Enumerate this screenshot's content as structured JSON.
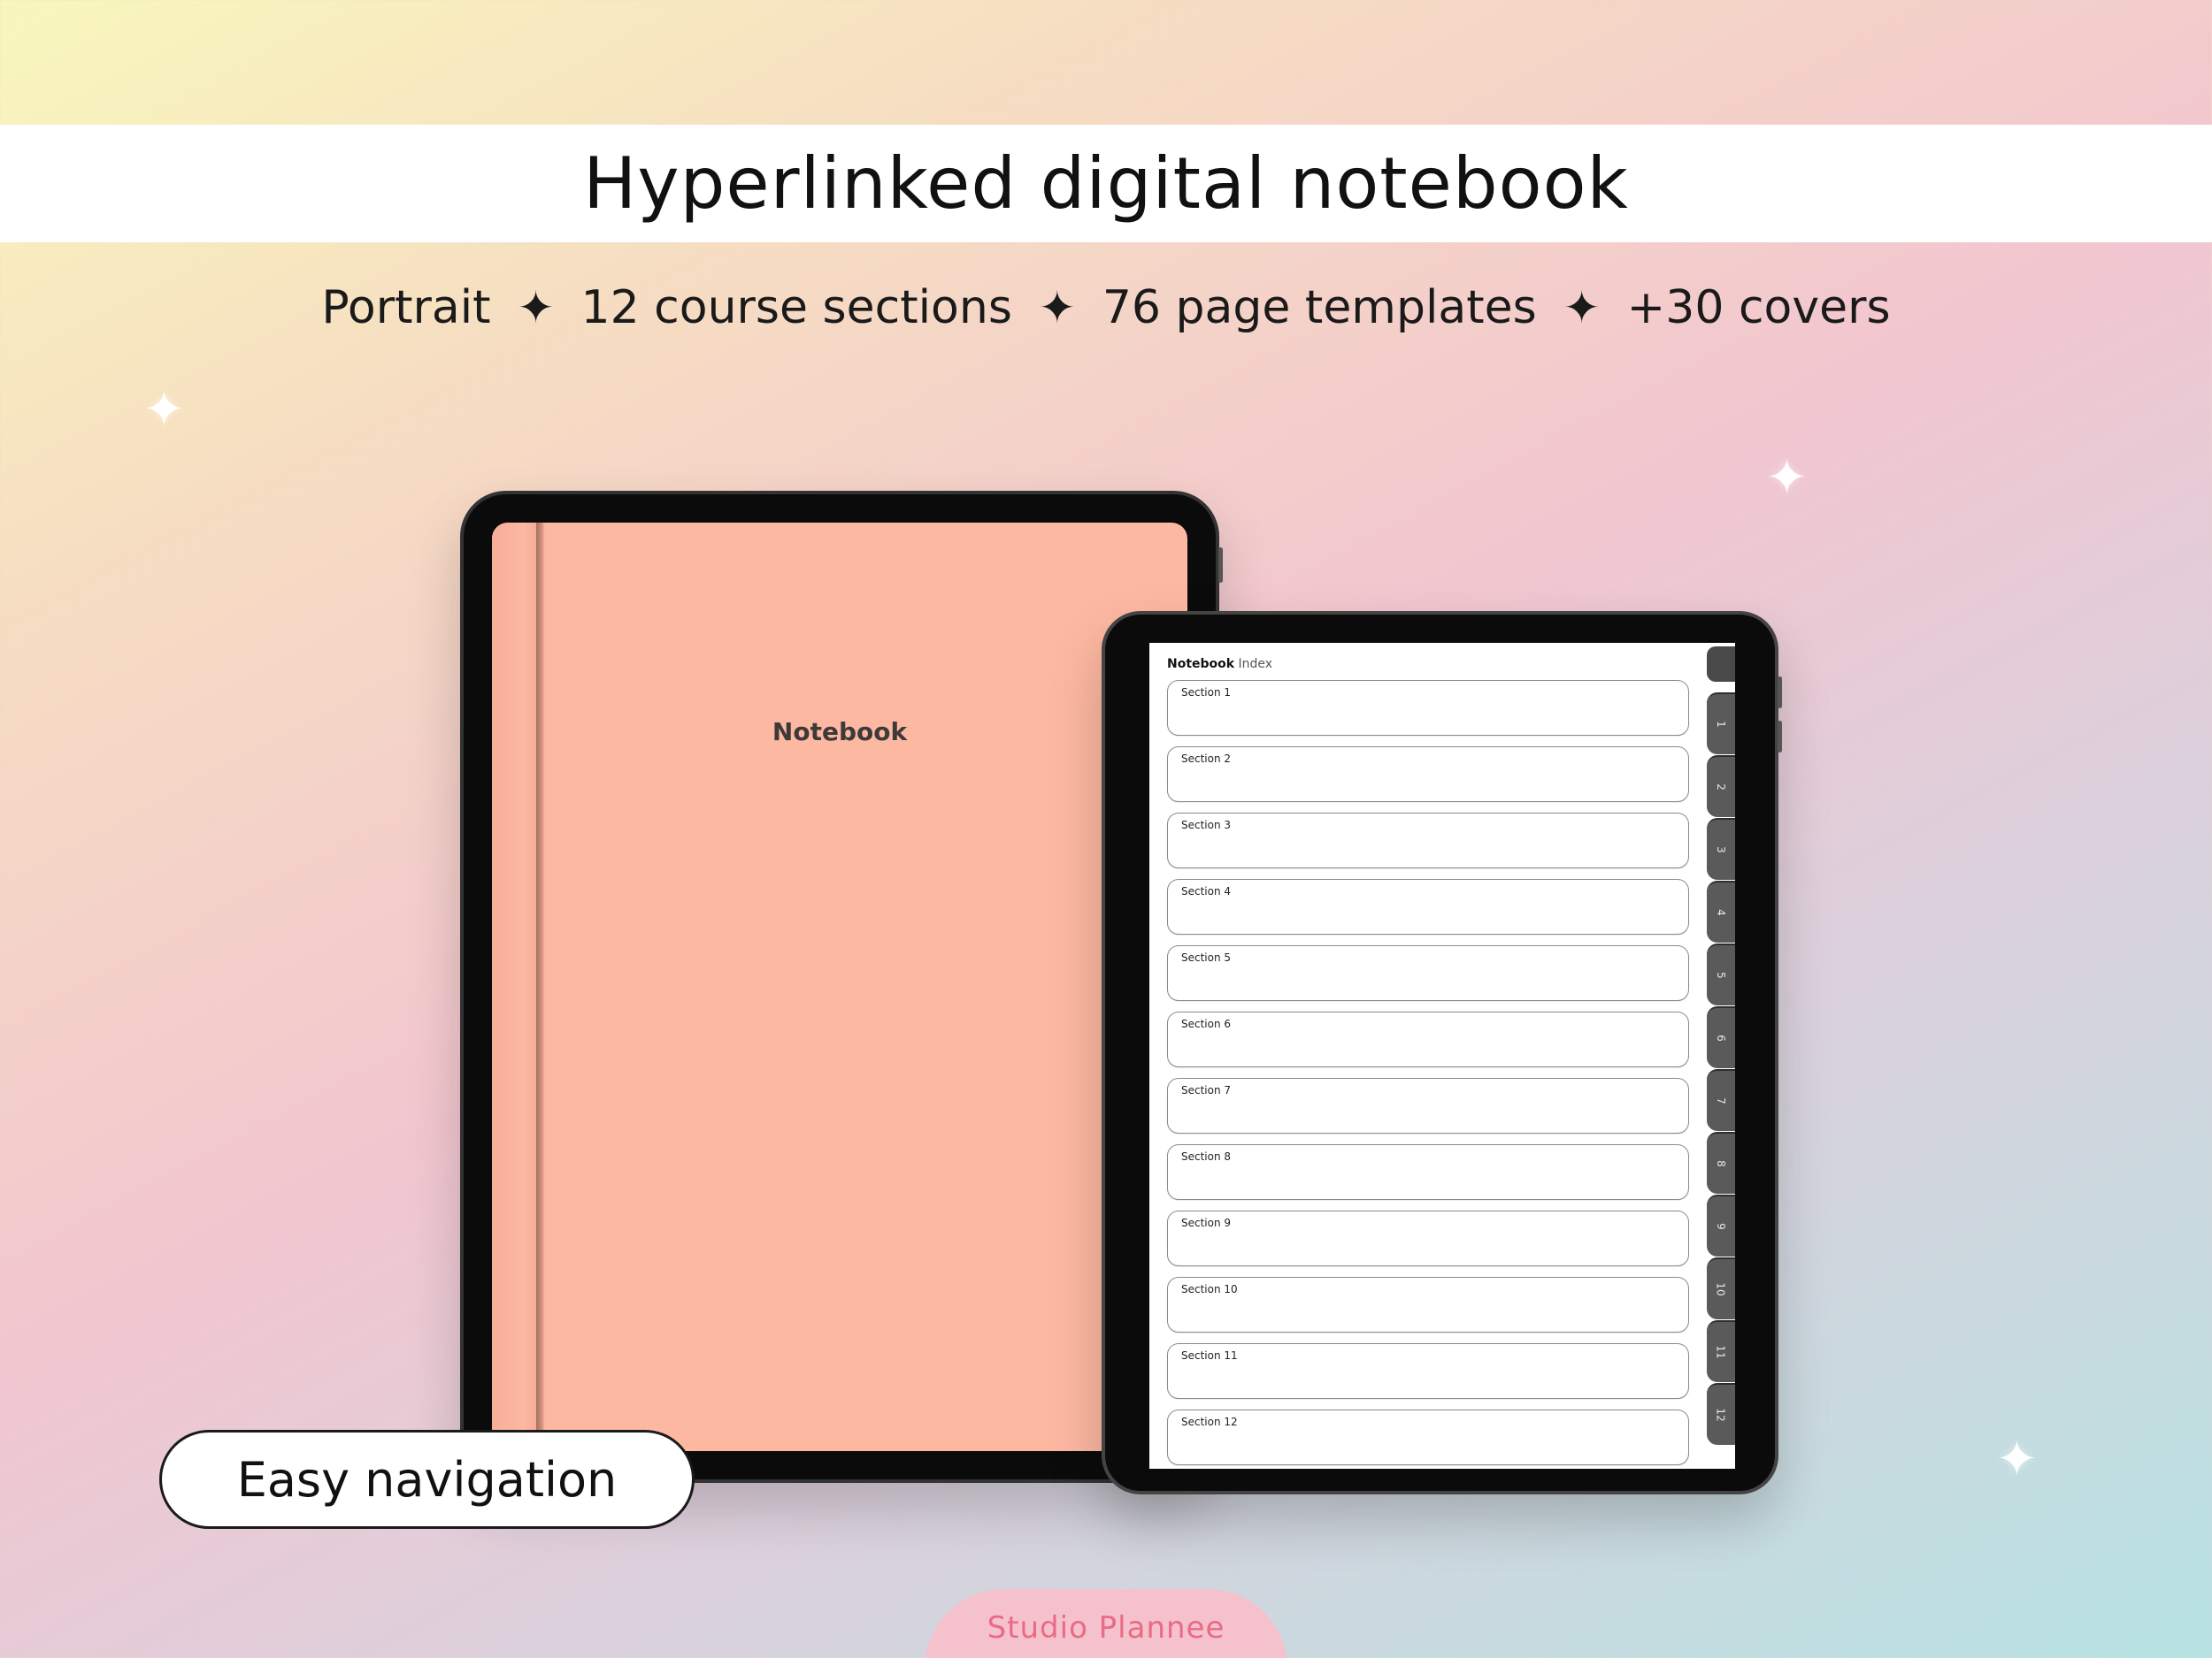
{
  "headline": "Hyperlinked digital notebook",
  "features": [
    "Portrait",
    "12 course sections",
    "76 page templates",
    "+30 covers"
  ],
  "feature_separator": "✦",
  "sparkle_glyph": "✦",
  "cover": {
    "title": "Notebook",
    "color": "#fdb8a2"
  },
  "index_page": {
    "title_bold": "Notebook",
    "title_rest": "Index",
    "sections": [
      "Section 1",
      "Section 2",
      "Section 3",
      "Section 4",
      "Section 5",
      "Section 6",
      "Section 7",
      "Section 8",
      "Section 9",
      "Section 10",
      "Section 11",
      "Section 12"
    ],
    "tabs": [
      "1",
      "2",
      "3",
      "4",
      "5",
      "6",
      "7",
      "8",
      "9",
      "10",
      "11",
      "12"
    ]
  },
  "badge": "Easy navigation",
  "brand": "Studio Plannee",
  "colors": {
    "brand_pink": "#e96b86",
    "tab_gray": "#5a5a5a"
  }
}
